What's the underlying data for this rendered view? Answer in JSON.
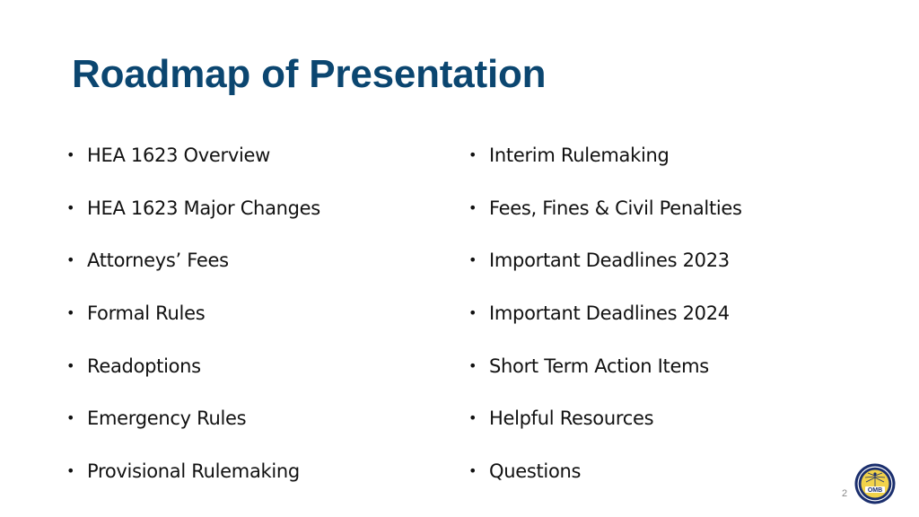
{
  "slide": {
    "title": "Roadmap of Presentation",
    "page_number": "2",
    "logo_text": "OMB",
    "colors": {
      "title": "#0b4670",
      "body_text": "#111111",
      "logo_navy": "#1b2f6e",
      "logo_gold": "#f2d34a"
    },
    "left_items": [
      {
        "label": "HEA 1623 Overview"
      },
      {
        "label": "HEA 1623 Major Changes"
      },
      {
        "label": "Attorneys’ Fees"
      },
      {
        "label": "Formal Rules"
      },
      {
        "label": "Readoptions"
      },
      {
        "label": "Emergency Rules"
      },
      {
        "label": "Provisional Rulemaking"
      }
    ],
    "right_items": [
      {
        "label": "Interim Rulemaking"
      },
      {
        "label": "Fees, Fines & Civil Penalties"
      },
      {
        "label": "Important Deadlines 2023"
      },
      {
        "label": "Important Deadlines 2024"
      },
      {
        "label": "Short Term Action Items"
      },
      {
        "label": "Helpful Resources"
      },
      {
        "label": "Questions"
      }
    ],
    "bullet_glyph": "•"
  }
}
